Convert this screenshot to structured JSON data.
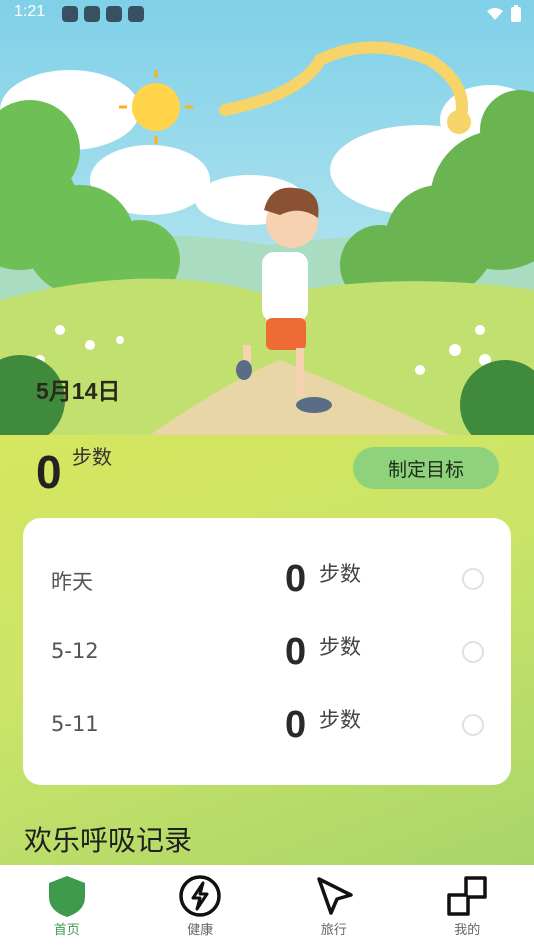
{
  "status_bar": {
    "time": "1:21"
  },
  "hero": {
    "date": "5月14日"
  },
  "today": {
    "steps": "0",
    "unit": "步数",
    "goal_button": "制定目标"
  },
  "history": [
    {
      "label": "昨天",
      "value": "0",
      "unit": "步数"
    },
    {
      "label": "5-12",
      "value": "0",
      "unit": "步数"
    },
    {
      "label": "5-11",
      "value": "0",
      "unit": "步数"
    }
  ],
  "section_title": "欢乐呼吸记录",
  "nav": {
    "items": [
      {
        "label": "首页",
        "icon": "shield-icon",
        "active": true
      },
      {
        "label": "健康",
        "icon": "lightning-icon",
        "active": false
      },
      {
        "label": "旅行",
        "icon": "cursor-arrow-icon",
        "active": false
      },
      {
        "label": "我的",
        "icon": "blocks-icon",
        "active": false
      }
    ],
    "active_color": "#3d9b4b"
  },
  "colors": {
    "panel_bg": "#cbe468",
    "goal_button_bg": "#8ed37b",
    "card_bg": "#ffffff"
  }
}
